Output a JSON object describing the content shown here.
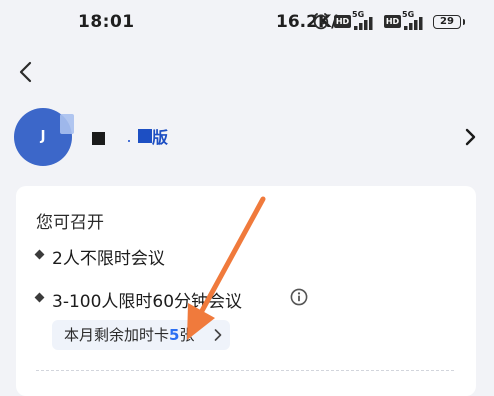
{
  "status_bar": {
    "time": "18:01",
    "net_speed": "16.2K/s",
    "sim1_badge": "HD",
    "sim1_network": "5G",
    "sim2_badge": "HD",
    "sim2_network": "5G",
    "battery": "29"
  },
  "profile": {
    "avatar_initial": "J",
    "edition_label": "版"
  },
  "card": {
    "title": "您可召开",
    "features": [
      {
        "text": "2人不限时会议"
      },
      {
        "text": "3-100人限时60分钟会议"
      }
    ],
    "bonus_prefix": "本月剩余加时卡",
    "bonus_count": "5",
    "bonus_suffix": "张"
  },
  "icons": {
    "back": "back-arrow-icon",
    "alarm": "alarm-clock-icon",
    "profile_chevron": "chevron-right-icon",
    "info": "info-circle-icon",
    "pill_chevron": "chevron-right-icon"
  },
  "colors": {
    "accent_blue": "#2b6ff2",
    "avatar_blue": "#3c67c9",
    "annotation_arrow": "#f07a3c",
    "background": "#f2f3f7"
  }
}
